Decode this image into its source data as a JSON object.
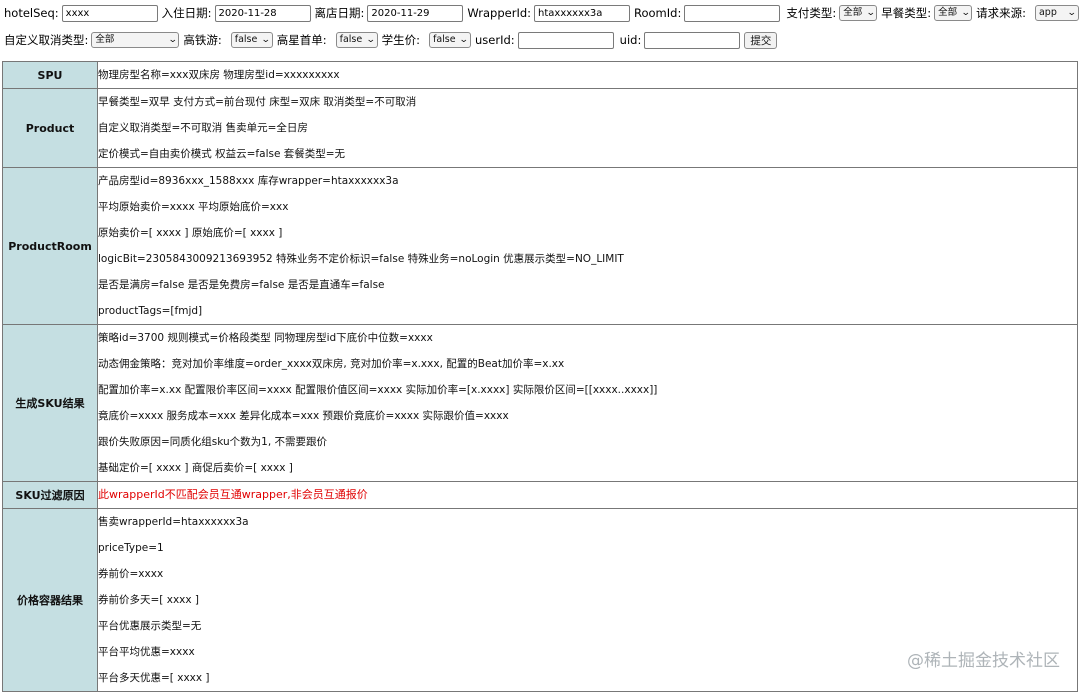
{
  "form": {
    "row1": {
      "hotelSeq": {
        "label": "hotelSeq:",
        "value": "xxxx"
      },
      "checkin": {
        "label": "入住日期:",
        "value": "2020-11-28"
      },
      "checkout": {
        "label": "离店日期:",
        "value": "2020-11-29"
      },
      "wrapperId": {
        "label": "WrapperId:",
        "value": "htaxxxxxx3a"
      },
      "roomId": {
        "label": "RoomId:",
        "value": ""
      },
      "payType": {
        "label": "支付类型:",
        "value": "全部"
      },
      "breakfastType": {
        "label": "早餐类型:",
        "value": "全部"
      },
      "requestSource": {
        "label": "请求来源:",
        "value": "app"
      }
    },
    "row2": {
      "cancelType": {
        "label": "自定义取消类型:",
        "value": "全部"
      },
      "railTour": {
        "label": "高铁游:",
        "value": "false"
      },
      "starFirst": {
        "label": "高星首单:",
        "value": "false"
      },
      "studentPrice": {
        "label": "学生价:",
        "value": "false"
      },
      "userId": {
        "label": "userId:",
        "value": ""
      },
      "uid": {
        "label": "uid:",
        "value": ""
      },
      "submit": "提交"
    }
  },
  "sections": {
    "spu": {
      "title": "SPU",
      "lines": [
        "物理房型名称=xxx双床房 物理房型id=xxxxxxxxx"
      ]
    },
    "product": {
      "title": "Product",
      "lines": [
        "早餐类型=双早 支付方式=前台现付 床型=双床 取消类型=不可取消",
        "自定义取消类型=不可取消 售卖单元=全日房",
        "定价模式=自由卖价模式 权益云=false 套餐类型=无"
      ]
    },
    "productRoom": {
      "title": "ProductRoom",
      "lines": [
        "产品房型id=8936xxx_1588xxx 库存wrapper=htaxxxxxx3a",
        "平均原始卖价=xxxx 平均原始底价=xxx",
        "原始卖价=[ xxxx ] 原始底价=[ xxxx ]",
        "logicBit=2305843009213693952 特殊业务不定价标识=false 特殊业务=noLogin 优惠展示类型=NO_LIMIT",
        "是否是满房=false 是否是免费房=false 是否是直通车=false",
        "productTags=[fmjd]"
      ]
    },
    "sku": {
      "title": "生成SKU结果",
      "lines": [
        "策略id=3700 规则模式=价格段类型 同物理房型id下底价中位数=xxxx",
        "动态佣金策略：竞对加价率维度=order_xxxx双床房, 竞对加价率=x.xxx, 配置的Beat加价率=x.xx",
        "配置加价率=x.xx 配置限价率区间=xxxx 配置限价值区间=xxxx 实际加价率=[x.xxxx] 实际限价区间=[[xxxx..xxxx]]",
        "竟底价=xxxx 服务成本=xxx 差异化成本=xxx 预跟价竟底价=xxxx 实际跟价值=xxxx",
        "跟价失败原因=同质化组sku个数为1, 不需要跟价",
        "基础定价=[ xxxx ] 商促后卖价=[ xxxx ]"
      ]
    },
    "skuFilter": {
      "title": "SKU过滤原因",
      "lines": [
        "此wrapperId不匹配会员互通wrapper,非会员互通报价"
      ]
    },
    "priceContainer": {
      "title": "价格容器结果",
      "lines": [
        "售卖wrapperId=htaxxxxxx3a",
        "priceType=1",
        "券前价=xxxx",
        "券前价多天=[ xxxx ]",
        "平台优惠展示类型=无",
        "平台平均优惠=xxxx",
        "平台多天优惠=[ xxxx ]"
      ]
    }
  },
  "colors": {
    "headerBg": "#c5dfe2",
    "warning": "#e00000",
    "border": "#777777"
  },
  "watermark": "@稀土掘金技术社区"
}
